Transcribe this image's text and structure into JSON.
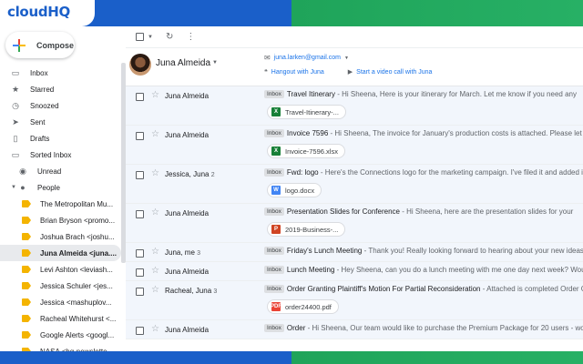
{
  "brand": {
    "logo": "cloudHQ",
    "blue": "#1a5fc9",
    "green": "#27b065"
  },
  "sidebar": {
    "compose_label": "Compose",
    "items": [
      {
        "label": "Inbox",
        "icon": "inbox-icon",
        "glyph": "▭"
      },
      {
        "label": "Starred",
        "icon": "star-icon",
        "glyph": "★"
      },
      {
        "label": "Snoozed",
        "icon": "clock-icon",
        "glyph": "◷"
      },
      {
        "label": "Sent",
        "icon": "send-icon",
        "glyph": "➤"
      },
      {
        "label": "Drafts",
        "icon": "draft-icon",
        "glyph": "▯"
      },
      {
        "label": "Sorted Inbox",
        "icon": "inbox-icon",
        "glyph": "▭"
      }
    ],
    "unread_label": "Unread",
    "people_label": "People",
    "people": [
      "The Metropolitan Mu...",
      "Brian Bryson <promo...",
      "Joshua Brach <joshu...",
      "Juna Almeida <juna....",
      "Levi Ashton <leviash...",
      "Jessica Schuler <jes...",
      "Jessica <mashuplov...",
      "Racheal Whitehurst <...",
      "Google Alerts <googl...",
      "NASA <hq-newslette..."
    ],
    "active_person_index": 3
  },
  "toolbar": {
    "refresh": "↻",
    "more": "⋮"
  },
  "contact": {
    "name": "Juna Almeida",
    "email": "juna.larken@gmail.com",
    "hangout": "Hangout with Juna",
    "video": "Start a video call with Juna"
  },
  "emails": [
    {
      "sender": "Juna Almeida",
      "count": "",
      "label": "Inbox",
      "subject": "Travel Itinerary",
      "snippet": " - Hi Sheena, Here is your itinerary for March. Let me know if you need any",
      "attachment": {
        "name": "Travel-Itinerary-...",
        "type": "X",
        "color": "#188038"
      }
    },
    {
      "sender": "Juna Almeida",
      "count": "",
      "label": "Inbox",
      "subject": "Invoice 7596",
      "snippet": " - Hi Sheena, The invoice for January's production costs is attached. Please let me",
      "attachment": {
        "name": "Invoice-7596.xlsx",
        "type": "X",
        "color": "#188038"
      }
    },
    {
      "sender": "Jessica, Juna",
      "count": "2",
      "label": "Inbox",
      "subject": "Fwd: logo",
      "snippet": " - Here's the Connections logo for the marketing campaign. I've filed it and added it",
      "attachment": {
        "name": "logo.docx",
        "type": "W",
        "color": "#4285f4"
      }
    },
    {
      "sender": "Juna Almeida",
      "count": "",
      "label": "Inbox",
      "subject": "Presentation Slides for Conference",
      "snippet": " - Hi Sheena, here are the presentation slides for your",
      "attachment": {
        "name": "2019-Business-...",
        "type": "P",
        "color": "#d04423"
      }
    },
    {
      "sender": "Juna, me",
      "count": "3",
      "label": "Inbox",
      "subject": "Friday's Lunch Meeting",
      "snippet": " - Thank you! Really looking forward to hearing about your new ideas for",
      "attachment": null
    },
    {
      "sender": "Juna Almeida",
      "count": "",
      "label": "Inbox",
      "subject": "Lunch Meeting",
      "snippet": " - Hey Sheena, can you do a lunch meeting with me one day next week? Would",
      "attachment": null
    },
    {
      "sender": "Racheal, Juna",
      "count": "3",
      "label": "Inbox",
      "subject": "Order Granting Plaintiff's Motion For Partial Reconsideration",
      "snippet": " - Attached is completed Order Granting",
      "attachment": {
        "name": "order24400.pdf",
        "type": "PDF",
        "color": "#ea4335"
      }
    },
    {
      "sender": "Juna Almeida",
      "count": "",
      "label": "Inbox",
      "subject": "Order",
      "snippet": " - Hi Sheena, Our team would like to purchase the Premium Package for 20 users - would",
      "attachment": null
    }
  ]
}
